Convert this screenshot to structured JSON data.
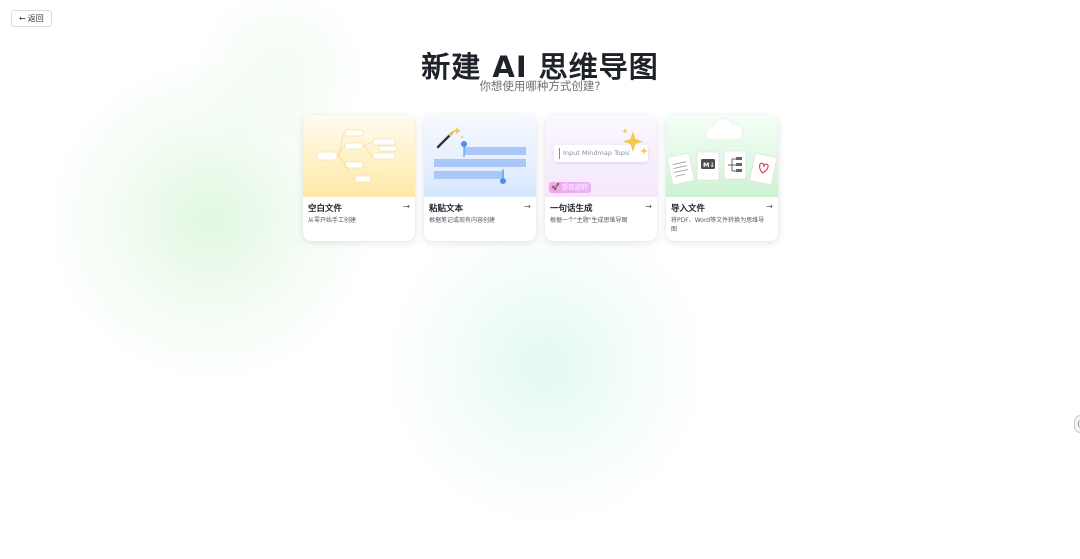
{
  "header": {
    "back_label": "返回",
    "back_arrow": "←"
  },
  "main": {
    "title": "新建 AI 思维导图",
    "subtitle": "你想使用哪种方式创建?"
  },
  "cards": [
    {
      "title": "空白文件",
      "desc": "从零开始手工创建",
      "arrow": "→",
      "icon": "mindmap-outline"
    },
    {
      "title": "粘贴文本",
      "desc": "根据笔记或现有内容创建",
      "arrow": "→",
      "icon": "magic-wand-text"
    },
    {
      "title": "一句话生成",
      "desc": "根据一个\"主题\"生成思维导图",
      "arrow": "→",
      "icon": "sparkle-prompt"
    },
    {
      "title": "导入文件",
      "desc": "将PDF、Word等文件转换为思维导图",
      "arrow": "→",
      "icon": "import-files"
    }
  ],
  "prompt_card": {
    "placeholder": "Input Mindmap  Topic",
    "chip_label": "受欢迎的"
  },
  "colors": {
    "title": "#1f2329",
    "subtitle": "#6b6f76",
    "accent_blue": "#4a8fe8",
    "chip_pink": "#f0a5f0"
  }
}
